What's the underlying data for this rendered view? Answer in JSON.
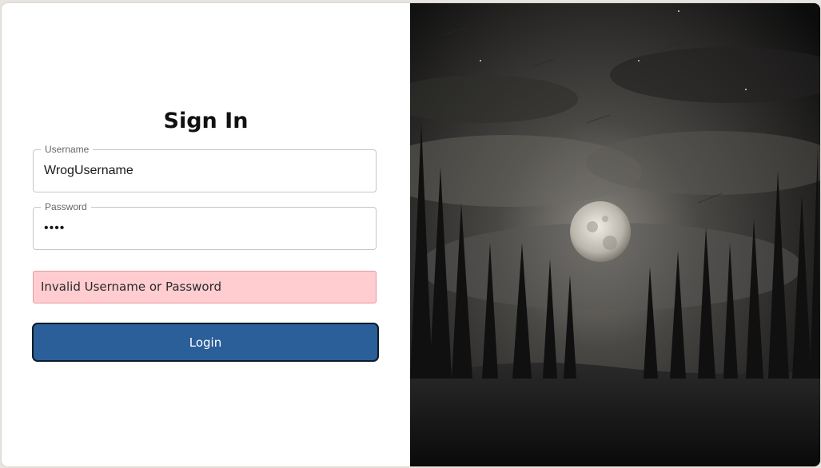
{
  "form": {
    "title": "Sign In",
    "username": {
      "label": "Username",
      "value": "WrogUsername"
    },
    "password": {
      "label": "Password",
      "value": "••••"
    },
    "error_message": "Invalid Username or Password",
    "login_label": "Login"
  },
  "colors": {
    "button": "#2a5f99",
    "error_background": "#ffcdd0",
    "error_border": "#e7999e"
  },
  "hero_image": {
    "icon": "moonlit-forest-illustration"
  }
}
